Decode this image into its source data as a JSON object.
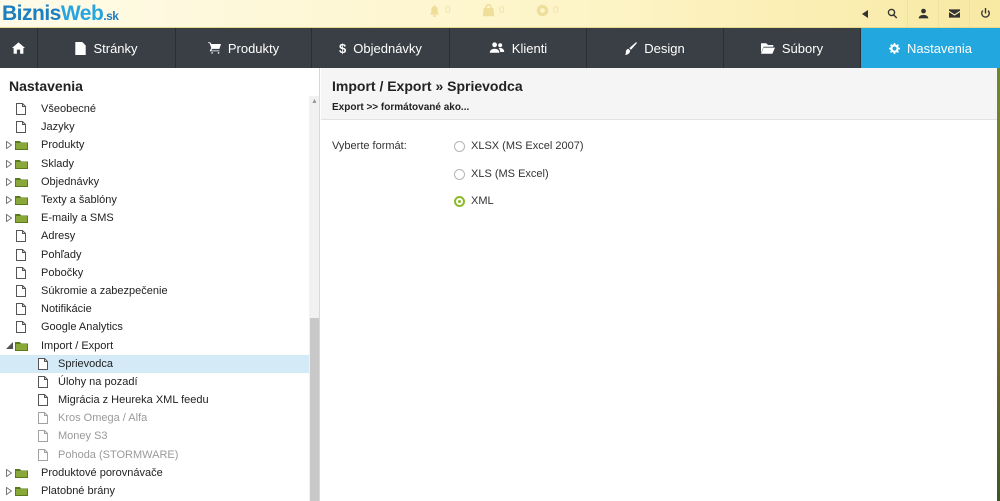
{
  "brand": {
    "part1": "Biznis",
    "part2": "Web",
    "part3": ".sk"
  },
  "top_notifications": [
    {
      "icon": "bell-icon",
      "count": "0"
    },
    {
      "icon": "bag-icon",
      "count": "0"
    },
    {
      "icon": "lifebuoy-icon",
      "count": "0"
    }
  ],
  "top_right_icons": [
    "collapse-arrow-icon",
    "search-icon",
    "user-icon",
    "mail-icon",
    "power-icon"
  ],
  "nav": [
    {
      "label": "",
      "icon": "home-icon"
    },
    {
      "label": "Stránky",
      "icon": "page-icon"
    },
    {
      "label": "Produkty",
      "icon": "cart-icon"
    },
    {
      "label": "Objednávky",
      "icon": "dollar-icon"
    },
    {
      "label": "Klienti",
      "icon": "users-icon"
    },
    {
      "label": "Design",
      "icon": "brush-icon"
    },
    {
      "label": "Súbory",
      "icon": "folder-open-icon"
    },
    {
      "label": "Nastavenia",
      "icon": "gear-icon",
      "active": true
    }
  ],
  "sidebar": {
    "title": "Nastavenia",
    "items": [
      {
        "label": "Všeobecné",
        "type": "page",
        "level": 0
      },
      {
        "label": "Jazyky",
        "type": "page",
        "level": 0
      },
      {
        "label": "Produkty",
        "type": "folder",
        "level": 0,
        "expanded": false
      },
      {
        "label": "Sklady",
        "type": "folder",
        "level": 0,
        "expanded": false
      },
      {
        "label": "Objednávky",
        "type": "folder",
        "level": 0,
        "expanded": false
      },
      {
        "label": "Texty a šablóny",
        "type": "folder",
        "level": 0,
        "expanded": false
      },
      {
        "label": "E-maily a SMS",
        "type": "folder",
        "level": 0,
        "expanded": false
      },
      {
        "label": "Adresy",
        "type": "page",
        "level": 0
      },
      {
        "label": "Pohľady",
        "type": "page",
        "level": 0
      },
      {
        "label": "Pobočky",
        "type": "page",
        "level": 0
      },
      {
        "label": "Súkromie a zabezpečenie",
        "type": "page",
        "level": 0
      },
      {
        "label": "Notifikácie",
        "type": "page",
        "level": 0
      },
      {
        "label": "Google Analytics",
        "type": "page",
        "level": 0
      },
      {
        "label": "Import / Export",
        "type": "folder",
        "level": 0,
        "expanded": true
      },
      {
        "label": "Sprievodca",
        "type": "page",
        "level": 1,
        "selected": true
      },
      {
        "label": "Úlohy na pozadí",
        "type": "page",
        "level": 1
      },
      {
        "label": "Migrácia z Heureka XML feedu",
        "type": "page",
        "level": 1
      },
      {
        "label": "Kros Omega / Alfa",
        "type": "page",
        "level": 1,
        "disabled": true
      },
      {
        "label": "Money S3",
        "type": "page",
        "level": 1,
        "disabled": true
      },
      {
        "label": "Pohoda (STORMWARE)",
        "type": "page",
        "level": 1,
        "disabled": true
      },
      {
        "label": "Produktové porovnávače",
        "type": "folder",
        "level": 0,
        "expanded": false
      },
      {
        "label": "Platobné brány",
        "type": "folder",
        "level": 0,
        "expanded": false
      }
    ]
  },
  "main": {
    "title": "Import / Export » Sprievodca",
    "subtitle": "Export >> formátované ako...",
    "format_label": "Vyberte formát:",
    "options": [
      {
        "label": "XLSX (MS Excel 2007)",
        "checked": false
      },
      {
        "label": "XLS (MS Excel)",
        "checked": false
      },
      {
        "label": "XML",
        "checked": true
      }
    ]
  },
  "colors": {
    "nav_bg": "#3a3f45",
    "nav_active": "#22a7df",
    "selected_row": "#d5eaf7",
    "radio_checked": "#8aba2a",
    "brand_blue": "#1b7fc2"
  }
}
